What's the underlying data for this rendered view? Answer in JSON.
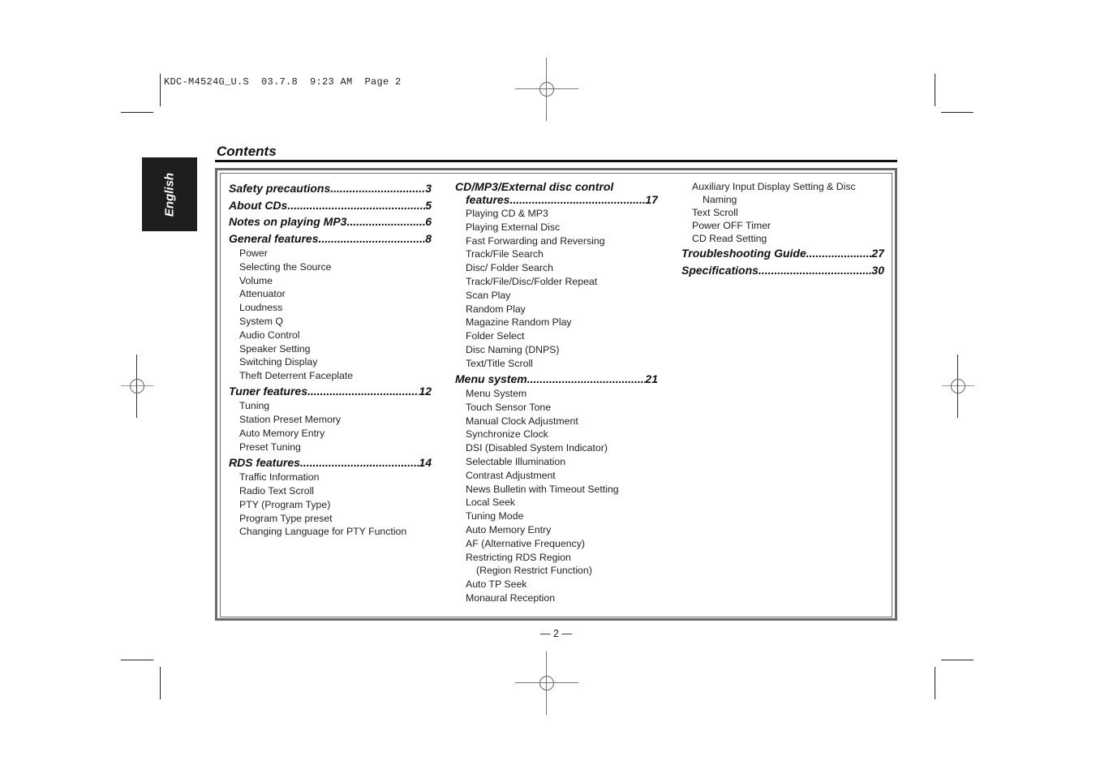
{
  "slug": "KDC-M4524G_U.S  03.7.8  9:23 AM  Page 2",
  "language_tab": "English",
  "page_title": "Contents",
  "page_number": "— 2 —",
  "columns": [
    {
      "sections": [
        {
          "title": "Safety precautions",
          "page": "3",
          "items": []
        },
        {
          "title": "About CDs",
          "page": "5",
          "items": []
        },
        {
          "title": "Notes on playing MP3 ",
          "page": "6",
          "items": []
        },
        {
          "title": "General features ",
          "page": "8",
          "items": [
            "Power",
            "Selecting the Source",
            "Volume",
            "Attenuator",
            "Loudness",
            "System Q",
            "Audio Control",
            "Speaker Setting",
            "Switching Display",
            "Theft Deterrent Faceplate"
          ]
        },
        {
          "title": "Tuner features",
          "page": "12",
          "items": [
            "Tuning",
            "Station Preset Memory",
            "Auto Memory Entry",
            "Preset Tuning"
          ]
        },
        {
          "title": "RDS features",
          "page": "14",
          "items": [
            "Traffic Information",
            "Radio Text Scroll",
            "PTY (Program Type)",
            "Program Type preset",
            "Changing Language for PTY Function"
          ]
        }
      ]
    },
    {
      "sections": [
        {
          "title_line1": "CD/MP3/External disc control",
          "title_line2": "features ",
          "page": "17",
          "items": [
            "Playing CD & MP3",
            "Playing External Disc",
            "Fast Forwarding and Reversing",
            "Track/File Search",
            "Disc/ Folder Search",
            "Track/File/Disc/Folder Repeat",
            "Scan Play",
            "Random Play",
            "Magazine Random Play",
            "Folder Select",
            "Disc Naming (DNPS)",
            "Text/Title Scroll"
          ]
        },
        {
          "title": "Menu system",
          "page": "21",
          "items": [
            "Menu System",
            "Touch Sensor Tone",
            "Manual Clock Adjustment",
            "Synchronize Clock",
            "DSI (Disabled System Indicator)",
            "Selectable Illumination",
            "Contrast Adjustment",
            "News Bulletin with Timeout Setting",
            "Local Seek",
            "Tuning Mode",
            "Auto Memory Entry",
            "AF (Alternative Frequency)",
            "Restricting RDS Region",
            "(Region Restrict Function)",
            "Auto TP Seek",
            "Monaural Reception"
          ]
        }
      ]
    },
    {
      "continued_items": [
        "Auxiliary Input Display Setting & Disc",
        "Naming",
        "Text Scroll",
        "Power OFF Timer",
        "CD Read Setting"
      ],
      "sections": [
        {
          "title": "Troubleshooting Guide ",
          "page": "27"
        },
        {
          "title": "Specifications ",
          "page": "30"
        }
      ]
    }
  ]
}
